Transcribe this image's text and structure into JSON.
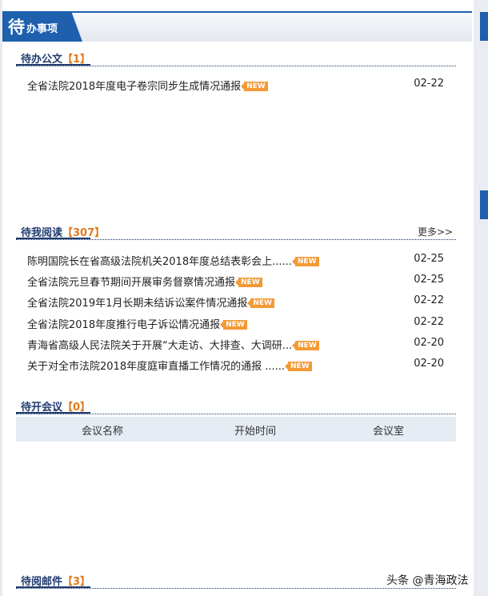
{
  "header": {
    "title_big": "待",
    "title_small": "办事项"
  },
  "sections": {
    "docs": {
      "title": "待办公文",
      "count": "【1】",
      "items": [
        {
          "title": "全省法院2018年度电子卷宗同步生成情况通报",
          "badge": "NEW",
          "date": "02-22"
        }
      ]
    },
    "reading": {
      "title": "待我阅读",
      "count": "【307】",
      "more": "更多>>",
      "items": [
        {
          "title": "陈明国院长在省高级法院机关2018年度总结表彰会上......",
          "badge": "NEW",
          "date": "02-25"
        },
        {
          "title": "全省法院元旦春节期间开展审务督察情况通报",
          "badge": "NEW",
          "date": "02-25"
        },
        {
          "title": "全省法院2019年1月长期未结诉讼案件情况通报",
          "badge": "NEW",
          "date": "02-22"
        },
        {
          "title": "全省法院2018年度推行电子诉讼情况通报",
          "badge": "NEW",
          "date": "02-22"
        },
        {
          "title": "青海省高级人民法院关于开展“大走访、大排查、大调研...",
          "badge": "NEW",
          "date": "02-20"
        },
        {
          "title": "关于对全市法院2018年度庭审直播工作情况的通报 ......",
          "badge": "NEW",
          "date": "02-20"
        }
      ]
    },
    "meetings": {
      "title": "待开会议",
      "count": "【0】",
      "columns": [
        "会议名称",
        "开始时间",
        "会议室"
      ]
    },
    "mail": {
      "title": "待阅邮件",
      "count": "【3】"
    }
  },
  "watermark": "头条 @青海政法",
  "colors": {
    "primary": "#1e5fae",
    "accent": "#e07a1f",
    "badge": "#f39a36"
  }
}
